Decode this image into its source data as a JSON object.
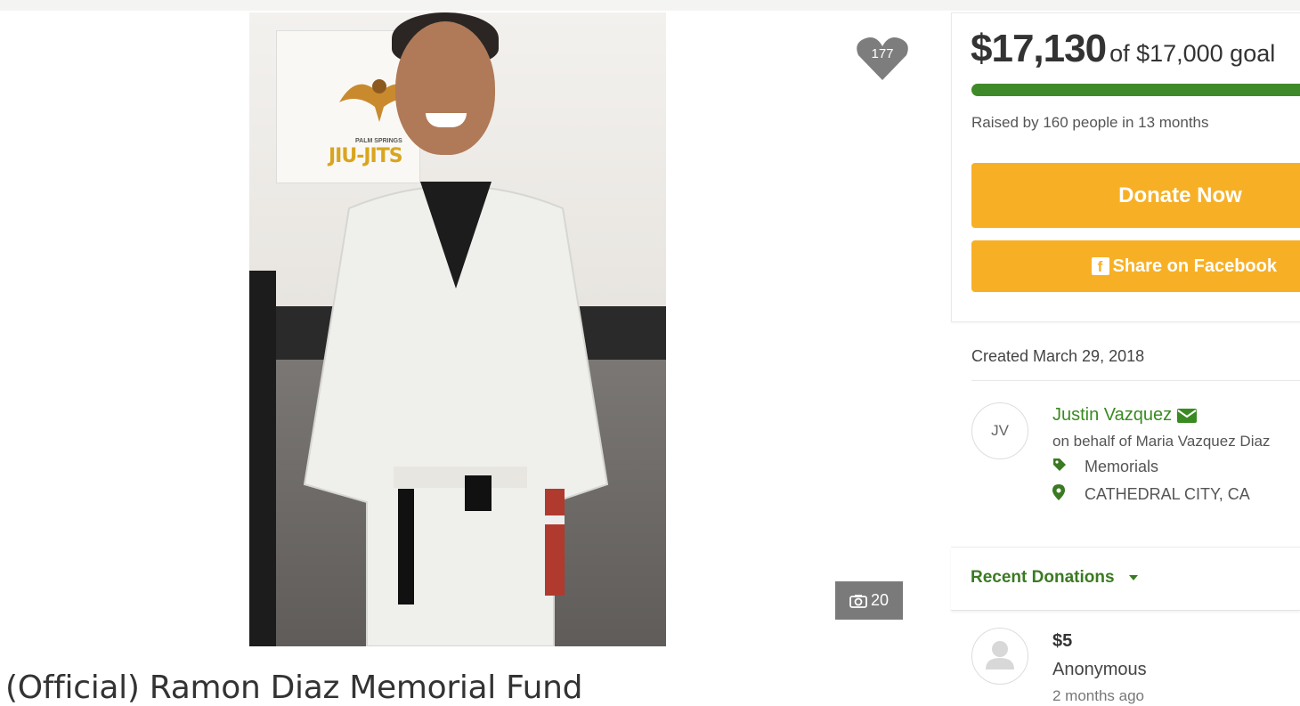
{
  "campaign": {
    "title": "(Official) Ramon Diaz Memorial Fund",
    "hearts": "177",
    "photo_count": "20"
  },
  "donation_box": {
    "amount_raised": "$17,130",
    "goal_text": "of $17,000 goal",
    "progress_fraction": 1.0,
    "raised_by": "Raised by 160 people in 13 months",
    "donate_label": "Donate Now",
    "share_label": "Share on Facebook"
  },
  "details": {
    "created": "Created March 29, 2018",
    "organizer_initials": "JV",
    "organizer_name": "Justin Vazquez",
    "on_behalf": "on behalf of Maria Vazquez Diaz",
    "category": "Memorials",
    "location": "CATHEDRAL CITY, CA"
  },
  "recent_donations": {
    "label": "Recent Donations",
    "items": [
      {
        "amount": "$5",
        "name": "Anonymous",
        "time": "2 months ago"
      }
    ]
  },
  "photo_banner": {
    "logo_text": "JIU-JITS",
    "logo_sub": "PALM SPRINGS"
  },
  "colors": {
    "brand_green": "#3f8a28",
    "button_orange": "#f7b026"
  },
  "icons": {
    "heart": "heart-icon",
    "camera": "camera-icon",
    "facebook": "facebook-icon",
    "envelope": "envelope-icon",
    "tag": "tag-icon",
    "location": "map-pin-icon",
    "caret": "caret-down-icon",
    "user": "user-silhouette-icon"
  }
}
